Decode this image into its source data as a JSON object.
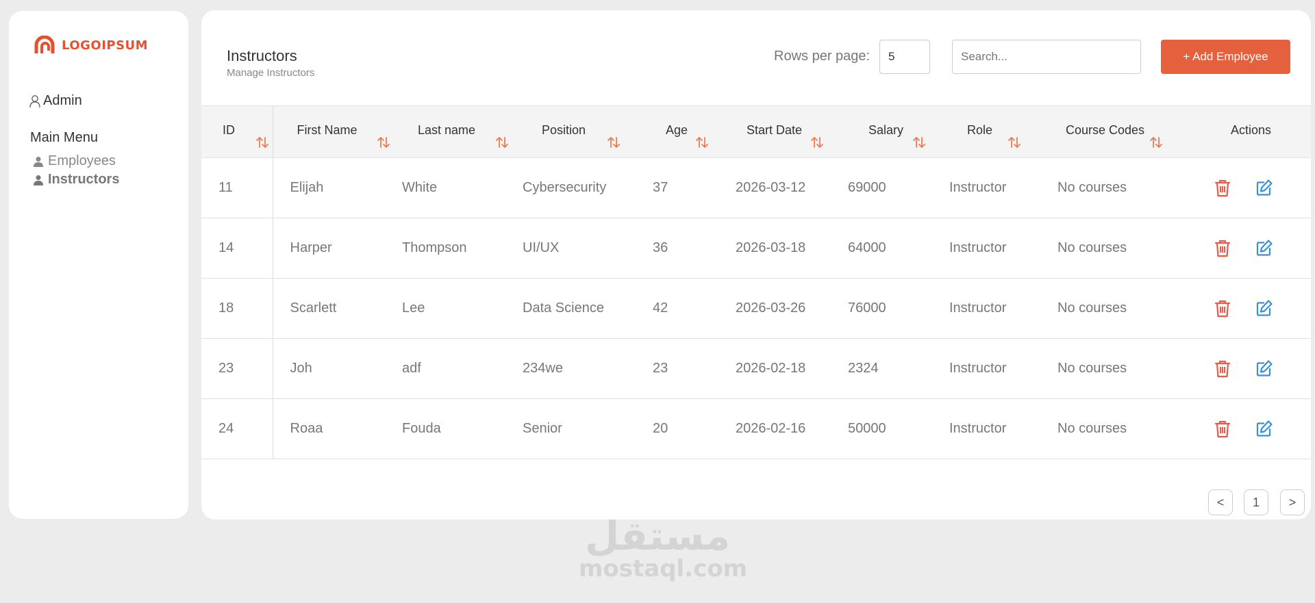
{
  "brand": {
    "name": "LOGOIPSUM",
    "color": "#e8502d"
  },
  "sidebar": {
    "user": "Admin",
    "menu_title": "Main Menu",
    "items": [
      {
        "label": "Employees",
        "icon": "user-icon",
        "active": false
      },
      {
        "label": "Instructors",
        "icon": "user-icon",
        "active": true
      }
    ]
  },
  "header": {
    "title": "Instructors",
    "subtitle": "Manage Instructors",
    "rows_per_page_label": "Rows per page:",
    "rows_per_page_value": "5",
    "search_placeholder": "Search...",
    "add_button": "+ Add Employee",
    "accent": "#e5603c"
  },
  "table": {
    "columns": [
      "ID",
      "First Name",
      "Last name",
      "Position",
      "Age",
      "Start Date",
      "Salary",
      "Role",
      "Course Codes",
      "Actions"
    ],
    "rows": [
      [
        "11",
        "Elijah",
        "White",
        "Cybersecurity",
        "37",
        "2026-03-12",
        "69000",
        "Instructor",
        "No courses"
      ],
      [
        "14",
        "Harper",
        "Thompson",
        "UI/UX",
        "36",
        "2026-03-18",
        "64000",
        "Instructor",
        "No courses"
      ],
      [
        "18",
        "Scarlett",
        "Lee",
        "Data Science",
        "42",
        "2026-03-26",
        "76000",
        "Instructor",
        "No courses"
      ],
      [
        "23",
        "Joh",
        "adf",
        "234we",
        "23",
        "2026-02-18",
        "2324",
        "Instructor",
        "No courses"
      ],
      [
        "24",
        "Roaa",
        "Fouda",
        "Senior",
        "20",
        "2026-02-16",
        "50000",
        "Instructor",
        "No courses"
      ]
    ]
  },
  "pagination": {
    "prev": "<",
    "page": "1",
    "next": ">"
  },
  "watermark": {
    "arabic": "مستقل",
    "latin": "mostaql.com"
  }
}
